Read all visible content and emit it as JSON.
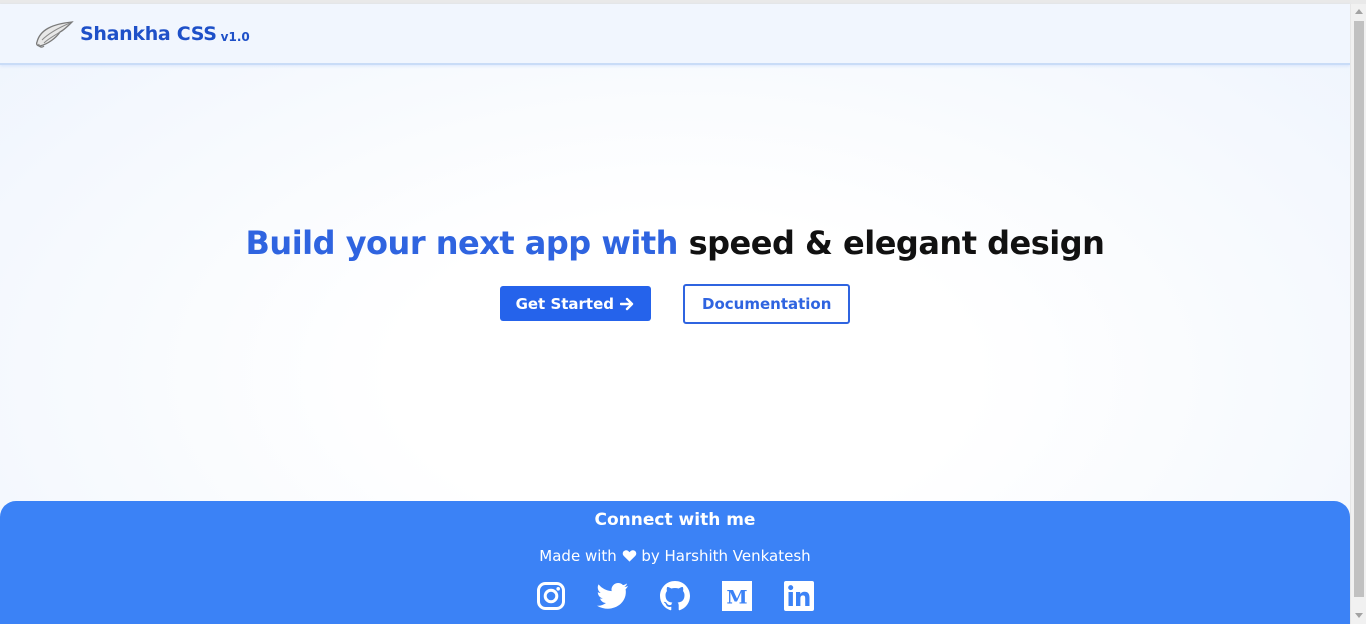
{
  "header": {
    "brand": "Shankha CSS",
    "version": "v1.0",
    "logo_icon": "conch-shell-icon"
  },
  "hero": {
    "headline_accent": "Build your next app with",
    "headline_dark": "speed & elegant design",
    "primary_button": "Get Started",
    "secondary_button": "Documentation"
  },
  "footer": {
    "title": "Connect with me",
    "made_with_prefix": "Made with",
    "made_with_suffix": "by Harshith Venkatesh",
    "social_icons": [
      "instagram-icon",
      "twitter-icon",
      "github-icon",
      "medium-icon",
      "linkedin-icon"
    ]
  },
  "colors": {
    "brand": "#1e50c8",
    "accent": "#2563eb",
    "footer_bg": "#3b82f6"
  }
}
